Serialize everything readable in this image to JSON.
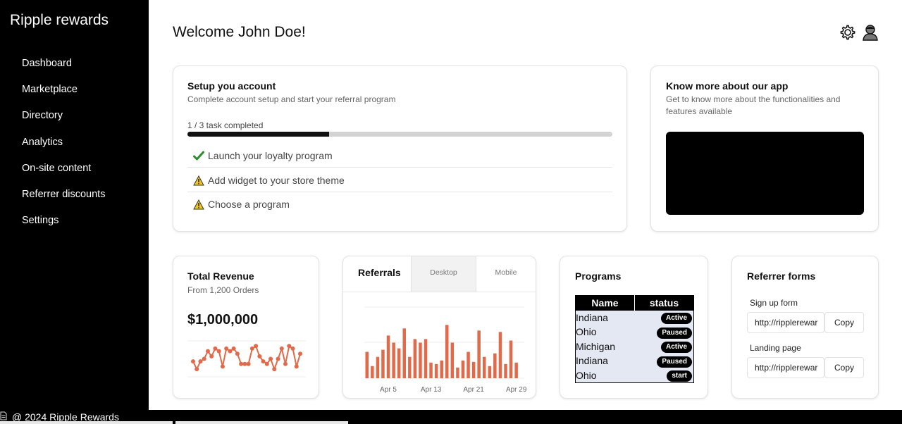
{
  "sidebar": {
    "brand": "Ripple rewards",
    "items": [
      {
        "label": "Dashboard"
      },
      {
        "label": "Marketplace"
      },
      {
        "label": "Directory"
      },
      {
        "label": "Analytics"
      },
      {
        "label": "On-site content"
      },
      {
        "label": "Referrer discounts"
      },
      {
        "label": "Settings"
      }
    ]
  },
  "header": {
    "welcome": "Welcome John Doe!",
    "icons": [
      "settings-gear-icon",
      "user-avatar-icon"
    ]
  },
  "setup": {
    "title": "Setup you account",
    "subtitle": "Complete account setup and start your referral program",
    "progress_label": "1 / 3 task completed",
    "progress_fraction": 0.333,
    "tasks": [
      {
        "label": "Launch your loyalty program",
        "status": "done",
        "icon": "check-icon"
      },
      {
        "label": "Add widget to your store theme",
        "status": "warning",
        "icon": "warning-icon"
      },
      {
        "label": "Choose a program",
        "status": "warning",
        "icon": "warning-icon"
      }
    ]
  },
  "know_more": {
    "title": "Know more about our app",
    "subtitle": "Get to know more about the functionalities and features available"
  },
  "revenue": {
    "title": "Total Revenue",
    "subtitle": "From 1,200 Orders",
    "value": "$1,000,000"
  },
  "referrals": {
    "title": "Referrals",
    "tabs": [
      {
        "label": "Desktop",
        "active": true
      },
      {
        "label": "Mobile",
        "active": false
      }
    ]
  },
  "programs": {
    "title": "Programs",
    "columns": [
      "Name",
      "status"
    ],
    "rows": [
      {
        "name": "Indiana",
        "status": "Active"
      },
      {
        "name": "Ohio",
        "status": "Paused"
      },
      {
        "name": "Michigan",
        "status": "Active"
      },
      {
        "name": "Indiana",
        "status": "Paused"
      },
      {
        "name": "Ohio",
        "status": "start"
      }
    ]
  },
  "forms": {
    "title": "Referrer forms",
    "items": [
      {
        "label": "Sign up form",
        "url": "http://ripplerewar",
        "button": "Copy"
      },
      {
        "label": "Landing page",
        "url": "http://ripplerewar",
        "button": "Copy"
      }
    ]
  },
  "footer": {
    "text": "@ 2024 Ripple Rewards"
  },
  "colors": {
    "sidebar_bg": "#000000",
    "accent": "#e06a4a",
    "success": "#2e8b2e",
    "warning": "#f2c811",
    "table_row_bg": "#e4e8f3"
  },
  "chart_data": [
    {
      "type": "line",
      "name": "revenue-sparkline",
      "title": "",
      "x": [
        1,
        2,
        3,
        4,
        5,
        6,
        7,
        8,
        9,
        10,
        11,
        12,
        13,
        14,
        15,
        16,
        17,
        18,
        19,
        20,
        21,
        22,
        23,
        24,
        25,
        26,
        27,
        28,
        29,
        30
      ],
      "values": [
        6,
        3,
        6,
        7,
        10,
        8,
        11,
        10,
        4,
        11,
        10,
        11,
        9,
        5,
        5,
        5,
        11,
        12,
        8,
        6,
        5,
        7,
        3,
        7,
        11,
        5,
        12,
        11,
        4,
        9
      ],
      "ylim": [
        0,
        14
      ],
      "grid": true
    },
    {
      "type": "bar",
      "name": "referrals-desktop",
      "title": "Referrals",
      "categories": [
        "Apr 1",
        "Apr 2",
        "Apr 3",
        "Apr 4",
        "Apr 5",
        "Apr 6",
        "Apr 7",
        "Apr 8",
        "Apr 9",
        "Apr 10",
        "Apr 11",
        "Apr 12",
        "Apr 13",
        "Apr 14",
        "Apr 15",
        "Apr 16",
        "Apr 17",
        "Apr 18",
        "Apr 19",
        "Apr 20",
        "Apr 21",
        "Apr 22",
        "Apr 23",
        "Apr 24",
        "Apr 25",
        "Apr 26",
        "Apr 27",
        "Apr 28",
        "Apr 29",
        "Apr 30"
      ],
      "tick_labels": [
        "Apr 5",
        "Apr 13",
        "Apr 21",
        "Apr 29"
      ],
      "values": [
        37,
        17,
        30,
        40,
        60,
        50,
        42,
        70,
        30,
        55,
        50,
        55,
        22,
        20,
        25,
        75,
        50,
        15,
        25,
        37,
        23,
        67,
        30,
        17,
        35,
        65,
        20,
        53,
        22,
        0
      ],
      "ylim": [
        0,
        100
      ],
      "grid": true
    }
  ]
}
